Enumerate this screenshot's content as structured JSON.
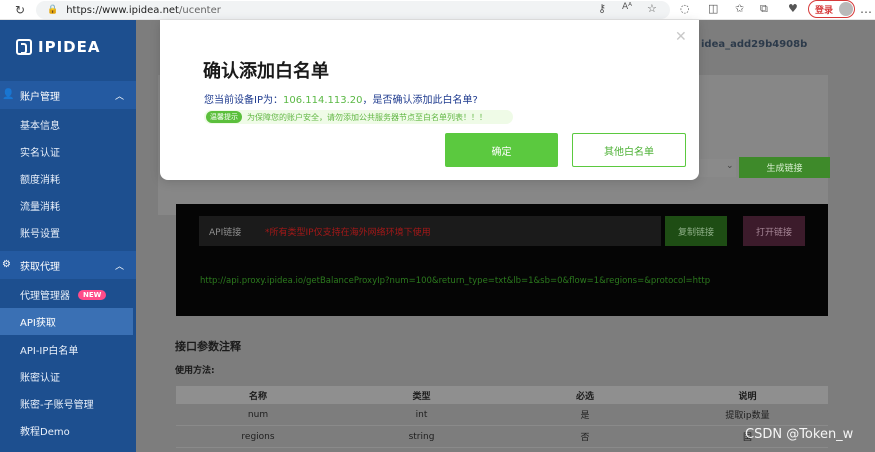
{
  "browser": {
    "url_host": "https://www.ipidea.net",
    "url_path": "/ucenter",
    "login_label": "登录"
  },
  "sidebar": {
    "logo": "IPIDEA",
    "groups": [
      {
        "label": "账户管理",
        "items": [
          "基本信息",
          "实名认证",
          "额度消耗",
          "流量消耗",
          "账号设置"
        ]
      },
      {
        "label": "获取代理",
        "items": [
          "代理管理器",
          "API获取",
          "API-IP白名单",
          "账密认证",
          "账密-子账号管理",
          "教程Demo"
        ]
      }
    ],
    "new_badge": "NEW",
    "active_item": "API获取"
  },
  "main": {
    "account_name": "idea_add29b4908b",
    "generate_label": "生成链接",
    "api_label": "API链接",
    "api_warning": "*所有类型IP仅支持在海外网络环境下使用",
    "copy_label": "复制链接",
    "open_label": "打开链接",
    "api_url": "http://api.proxy.ipidea.io/getBalanceProxyIp?num=100&return_type=txt&lb=1&sb=0&flow=1&regions=&protocol=http",
    "params_title": "接口参数注释",
    "usage_label": "使用方法:",
    "table": {
      "headers": [
        "名称",
        "类型",
        "必选",
        "说明"
      ],
      "rows": [
        [
          "num",
          "int",
          "是",
          "提取ip数量"
        ],
        [
          "regions",
          "string",
          "否",
          "国"
        ]
      ]
    }
  },
  "modal": {
    "title": "确认添加白名单",
    "ip_prefix": "您当前设备IP为：",
    "ip": "106.114.113.20",
    "ip_suffix": "，是否确认添加此白名单?",
    "tip_tag": "温馨提示",
    "tip_text": "为保障您的账户安全，请勿添加公共服务器节点至白名单列表！！！",
    "confirm_label": "确定",
    "other_label": "其他白名单"
  },
  "watermark": "CSDN @Token_w"
}
